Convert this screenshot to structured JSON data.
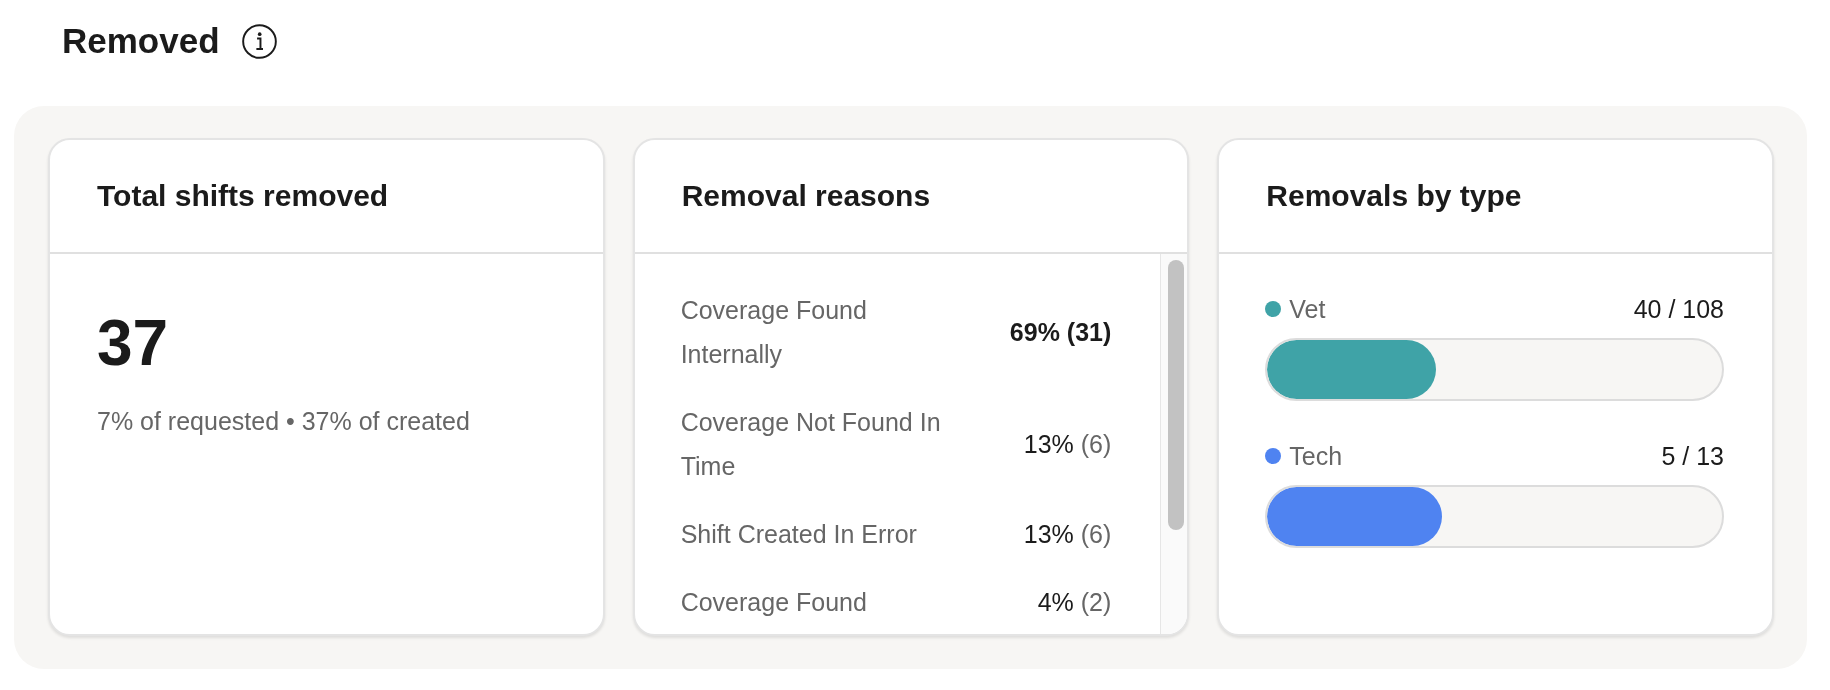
{
  "section": {
    "title": "Removed"
  },
  "cards": [
    {
      "kind": "stat",
      "title": "Total shifts removed",
      "value": "37",
      "caption": "7% of requested • 37% of created"
    },
    {
      "kind": "reasons",
      "title": "Removal reasons",
      "rows": [
        {
          "label": "Coverage Found Internally",
          "percent": "69%",
          "count": "(31)",
          "emphasized": true
        },
        {
          "label": "Coverage Not Found In Time",
          "percent": "13%",
          "count": "(6)",
          "emphasized": false
        },
        {
          "label": "Shift Created In Error",
          "percent": "13%",
          "count": "(6)",
          "emphasized": false
        },
        {
          "label": "Coverage Found",
          "percent": "4%",
          "count": "(2)",
          "emphasized": false
        }
      ]
    },
    {
      "kind": "types",
      "title": "Removals by type",
      "bars": [
        {
          "label": "Vet",
          "color": "#3fa3a7",
          "reading": "40 / 108",
          "level": 0.37
        },
        {
          "label": "Tech",
          "color": "#4f83f1",
          "reading": "5 / 13",
          "level": 0.385
        }
      ]
    }
  ]
}
